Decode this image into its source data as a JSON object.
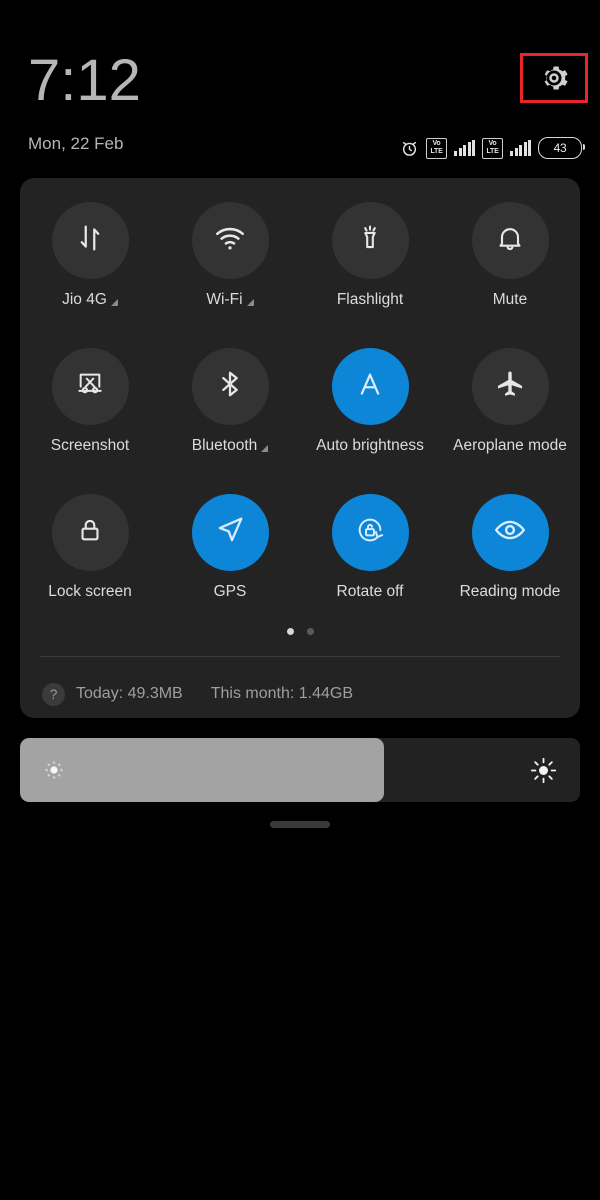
{
  "statusbar": {
    "clock": "7:12",
    "date": "Mon, 22 Feb",
    "settings_icon": "gear-icon",
    "highlight_color": "#e8252b",
    "icons": [
      {
        "name": "alarm-icon",
        "label": "Alarm set"
      },
      {
        "name": "volte-sim1-icon",
        "top": "Vo",
        "bottom": "LTE"
      },
      {
        "name": "signal-sim1-icon",
        "bars": 5
      },
      {
        "name": "volte-sim2-icon",
        "top": "Vo",
        "bottom": "LTE"
      },
      {
        "name": "signal-sim2-icon",
        "bars": 5
      }
    ],
    "battery": {
      "level": "43",
      "name": "battery-icon"
    }
  },
  "quick_settings": {
    "active_color": "#0e86d8",
    "inactive_color": "#333333",
    "panel_color": "#232323",
    "tiles": [
      {
        "label": "Jio 4G",
        "icon": "mobile-data-icon",
        "active": false,
        "has_arrow": true
      },
      {
        "label": "Wi-Fi",
        "icon": "wifi-icon",
        "active": false,
        "has_arrow": true
      },
      {
        "label": "Flashlight",
        "icon": "flashlight-icon",
        "active": false,
        "has_arrow": false
      },
      {
        "label": "Mute",
        "icon": "bell-icon",
        "active": false,
        "has_arrow": false
      },
      {
        "label": "Screenshot",
        "icon": "screenshot-icon",
        "active": false,
        "has_arrow": false
      },
      {
        "label": "Bluetooth",
        "icon": "bluetooth-icon",
        "active": false,
        "has_arrow": true
      },
      {
        "label": "Auto brightness",
        "icon": "auto-brightness-icon",
        "active": true,
        "has_arrow": false
      },
      {
        "label": "Aeroplane mode",
        "icon": "airplane-icon",
        "active": false,
        "has_arrow": false
      },
      {
        "label": "Lock screen",
        "icon": "lock-icon",
        "active": false,
        "has_arrow": false
      },
      {
        "label": "GPS",
        "icon": "location-arrow-icon",
        "active": true,
        "has_arrow": false
      },
      {
        "label": "Rotate off",
        "icon": "rotation-lock-icon",
        "active": true,
        "has_arrow": false
      },
      {
        "label": "Reading mode",
        "icon": "eye-icon",
        "active": true,
        "has_arrow": false
      }
    ],
    "pages": {
      "count": 2,
      "current": 1
    },
    "data_usage": {
      "help_icon": "?",
      "today": "Today: 49.3MB",
      "month": "This month: 1.44GB"
    }
  },
  "brightness": {
    "value_percent": 65,
    "low_icon": "brightness-low-icon",
    "high_icon": "brightness-high-icon"
  },
  "home_handle": "drag-handle"
}
